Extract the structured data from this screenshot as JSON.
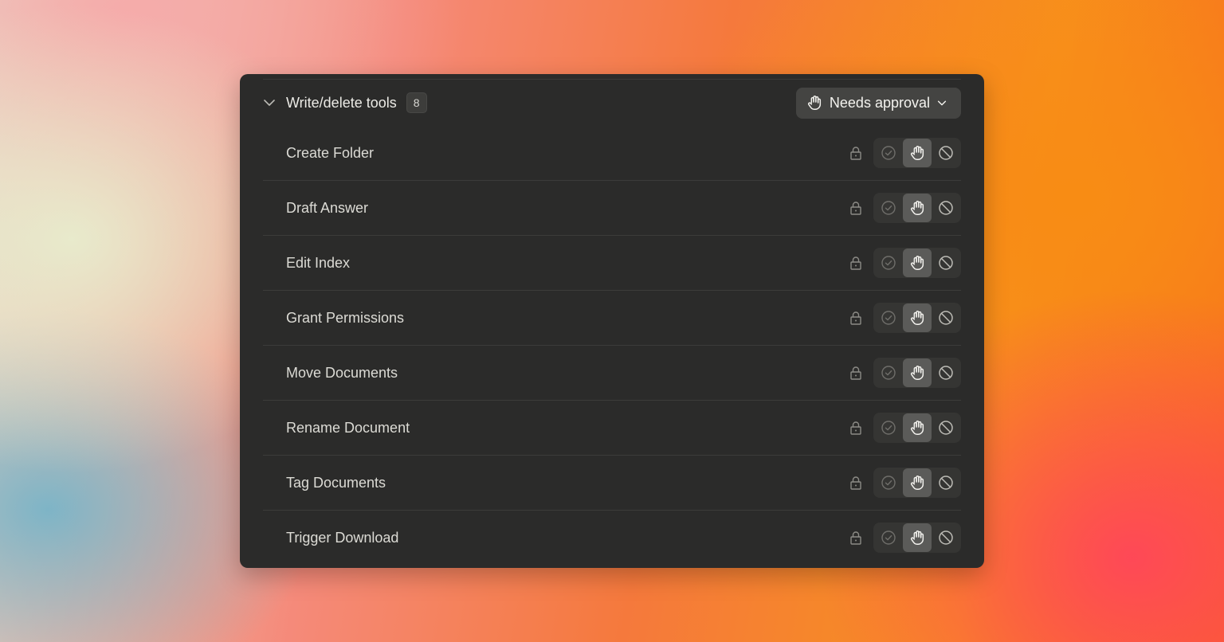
{
  "section": {
    "title": "Write/delete tools",
    "count": "8",
    "mode_label": "Needs approval"
  },
  "icons": {
    "collapse": "chevron-down-icon",
    "mode": "hand-icon",
    "lock": "lock-icon",
    "allow": "check-circle-icon",
    "approval": "hand-icon",
    "block": "block-icon"
  },
  "colors": {
    "panel": "#2b2b2a",
    "active_segment": "#5b5b59"
  },
  "tools": [
    {
      "label": "Create Folder",
      "mode": "approval"
    },
    {
      "label": "Draft Answer",
      "mode": "approval"
    },
    {
      "label": "Edit Index",
      "mode": "approval"
    },
    {
      "label": "Grant Permissions",
      "mode": "approval"
    },
    {
      "label": "Move Documents",
      "mode": "approval"
    },
    {
      "label": "Rename Document",
      "mode": "approval"
    },
    {
      "label": "Tag Documents",
      "mode": "approval"
    },
    {
      "label": "Trigger Download",
      "mode": "approval"
    }
  ]
}
